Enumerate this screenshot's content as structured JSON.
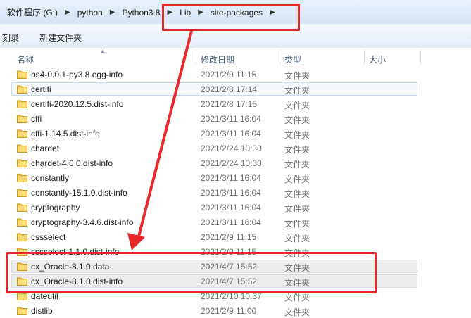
{
  "breadcrumb": [
    "软件程序 (G:)",
    "python",
    "Python3.8",
    "Lib",
    "site-packages"
  ],
  "toolbar": {
    "burn_label": "刻录",
    "new_folder_label": "新建文件夹"
  },
  "columns": {
    "name": "名称",
    "modified": "修改日期",
    "type": "类型",
    "size": "大小"
  },
  "files": [
    {
      "name": "bs4-0.0.1-py3.8.egg-info",
      "modified": "2021/2/9 11:15",
      "type": "文件夹"
    },
    {
      "name": "certifi",
      "modified": "2021/2/8 17:14",
      "type": "文件夹"
    },
    {
      "name": "certifi-2020.12.5.dist-info",
      "modified": "2021/2/8 17:15",
      "type": "文件夹"
    },
    {
      "name": "cffi",
      "modified": "2021/3/11 16:04",
      "type": "文件夹"
    },
    {
      "name": "cffi-1.14.5.dist-info",
      "modified": "2021/3/11 16:04",
      "type": "文件夹"
    },
    {
      "name": "chardet",
      "modified": "2021/2/24 10:30",
      "type": "文件夹"
    },
    {
      "name": "chardet-4.0.0.dist-info",
      "modified": "2021/2/24 10:30",
      "type": "文件夹"
    },
    {
      "name": "constantly",
      "modified": "2021/3/11 16:04",
      "type": "文件夹"
    },
    {
      "name": "constantly-15.1.0.dist-info",
      "modified": "2021/3/11 16:04",
      "type": "文件夹"
    },
    {
      "name": "cryptography",
      "modified": "2021/3/11 16:04",
      "type": "文件夹"
    },
    {
      "name": "cryptography-3.4.6.dist-info",
      "modified": "2021/3/11 16:04",
      "type": "文件夹"
    },
    {
      "name": "cssselect",
      "modified": "2021/2/9 11:15",
      "type": "文件夹"
    },
    {
      "name": "cssselect-1.1.0.dist-info",
      "modified": "2021/2/9 11:15",
      "type": "文件夹"
    },
    {
      "name": "cx_Oracle-8.1.0.data",
      "modified": "2021/4/7 15:52",
      "type": "文件夹"
    },
    {
      "name": "cx_Oracle-8.1.0.dist-info",
      "modified": "2021/4/7 15:52",
      "type": "文件夹"
    },
    {
      "name": "dateutil",
      "modified": "2021/2/10 10:37",
      "type": "文件夹"
    },
    {
      "name": "distlib",
      "modified": "2021/2/9 11:00",
      "type": "文件夹"
    }
  ],
  "colors": {
    "annotation_red": "#e8282a",
    "folder_yellow": "#f2c64d"
  },
  "icons": {
    "breadcrumb_separator": "separator-arrow-icon",
    "folder": "folder-icon"
  }
}
